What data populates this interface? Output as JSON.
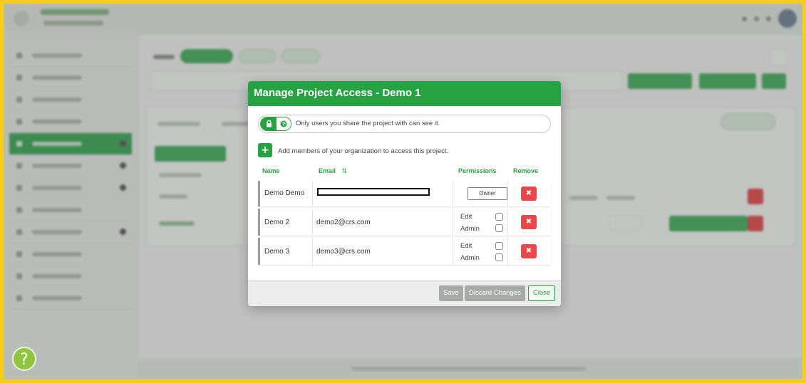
{
  "modal": {
    "title": "Manage Project Access - Demo 1",
    "visibility_text": "Only users you share the project with can see it.",
    "add_members_text": "Add members of your organization to access this project.",
    "columns": {
      "name": "Name",
      "email": "Email",
      "permissions": "Permissions",
      "remove": "Remove"
    },
    "rows": [
      {
        "name": "Demo Demo",
        "email": "",
        "role": "Owner"
      },
      {
        "name": "Demo 2",
        "email": "demo2@crs.com",
        "perm_edit": "Edit",
        "perm_admin": "Admin"
      },
      {
        "name": "Demo 3",
        "email": "demo3@crs.com",
        "perm_edit": "Edit",
        "perm_admin": "Admin"
      }
    ],
    "remove_symbol": "✖",
    "footer": {
      "save": "Save",
      "discard": "Discard Changes",
      "close": "Close"
    }
  },
  "help_button": "?",
  "icons": {
    "lock": "lock-icon",
    "globe": "globe-icon",
    "plus": "plus-icon",
    "sort": "sort-icon",
    "remove": "close-icon"
  },
  "colors": {
    "accent": "#27a243",
    "danger": "#e8484b",
    "frame_border": "#f7cd1b"
  }
}
